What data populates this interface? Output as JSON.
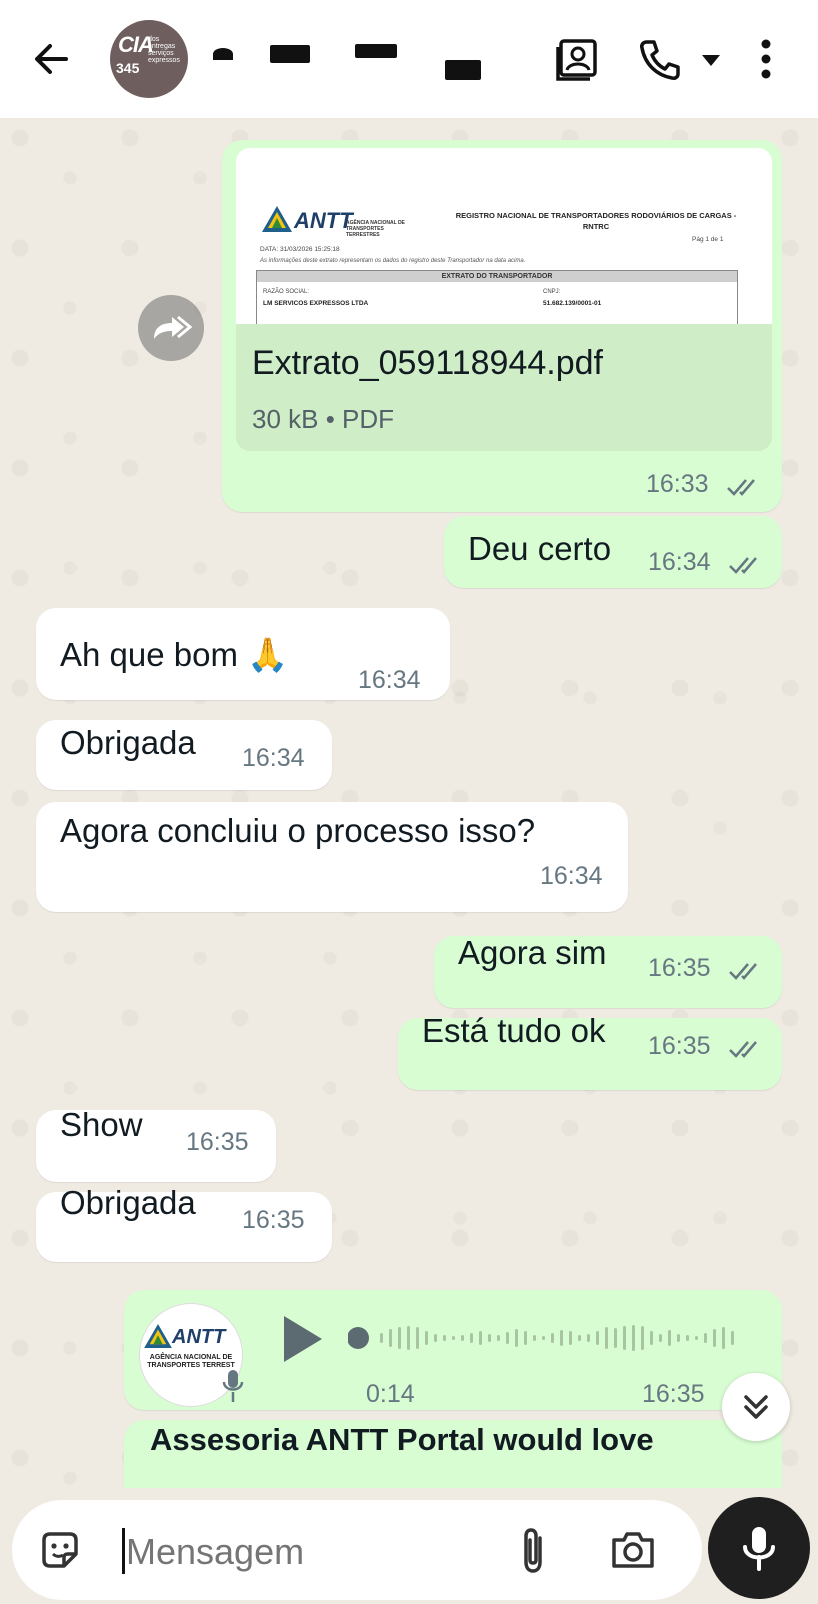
{
  "header": {
    "avatar": {
      "line1": "CIA",
      "line2": "dos entregas serviços expressos",
      "line3": "345"
    }
  },
  "messages": {
    "doc": {
      "filename": "Extrato_059118944.pdf",
      "meta": "30 kB • PDF",
      "time": "16:33",
      "preview": {
        "logo": "ANTT",
        "agency": "AGÊNCIA NACIONAL DE TRANSPORTES TERRESTRES",
        "title": "REGISTRO NACIONAL DE TRANSPORTADORES RODOVIÁRIOS DE CARGAS - RNTRC",
        "page": "Pág 1 de 1",
        "date": "DATA: 31/03/2026 15:25:18",
        "note": "As informações deste extrato representam os dados do registro deste Transportador na data acima.",
        "section": "EXTRATO DO TRANSPORTADOR",
        "label_left": "RAZÃO SOCIAL:",
        "value_left": "LM SERVICOS EXPRESSOS LTDA",
        "label_right": "CNPJ:",
        "value_right": "51.682.139/0001-01"
      }
    },
    "m1": {
      "text": "Deu certo",
      "time": "16:34"
    },
    "m2": {
      "text": "Ah que bom 🙏",
      "time": "16:34"
    },
    "m3": {
      "text": "Obrigada",
      "time": "16:34"
    },
    "m4": {
      "text": "Agora concluiu o processo isso?",
      "time": "16:34"
    },
    "m5": {
      "text": "Agora sim",
      "time": "16:35"
    },
    "m6": {
      "text": "Está tudo ok",
      "time": "16:35"
    },
    "m7": {
      "text": "Show",
      "time": "16:35"
    },
    "m8": {
      "text": "Obrigada",
      "time": "16:35"
    },
    "voice": {
      "avatar_logo": "ANTT",
      "avatar_sub": "AGÊNCIA NACIONAL DE TRANSPORTES TERREST",
      "duration": "0:14",
      "time": "16:35"
    },
    "m9_partial": {
      "text": "Assesoria ANTT Portal would love"
    }
  },
  "composer": {
    "placeholder": "Mensagem"
  },
  "colors": {
    "outgoing": "#d9fdd3",
    "incoming": "#ffffff",
    "ticks": "#667781"
  }
}
